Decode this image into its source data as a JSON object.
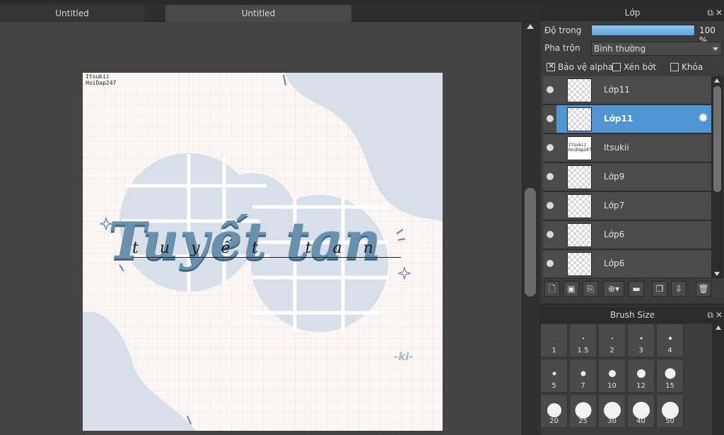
{
  "tabs": [
    "Untitled",
    "Untitled"
  ],
  "canvas": {
    "watermark_line1": "Itsukii",
    "watermark_line2": "HoiDap247",
    "headline": "Tuyết tan",
    "script_text": "tuyết tan",
    "signature": "-ki-",
    "colors": {
      "paper": "#fbf6f4",
      "grid": "#eadfe0",
      "blob": "#d7e0e8",
      "lettering": "#5f89a6"
    }
  },
  "layer_panel": {
    "title": "Lớp",
    "opacity_label": "Độ trong",
    "opacity_value": "100 %",
    "blend_label": "Pha trộn",
    "blend_value": "Bình thường",
    "checks": [
      {
        "label": "Bảo vệ alpha",
        "checked": true
      },
      {
        "label": "Xén bớt",
        "checked": false
      },
      {
        "label": "Khóa",
        "checked": false
      }
    ],
    "layers": [
      {
        "name": "Lớp11",
        "selected": false,
        "thumb": "transparent"
      },
      {
        "name": "Lớp11",
        "selected": true,
        "thumb": "transparent"
      },
      {
        "name": "Itsukii",
        "selected": false,
        "thumb": "text"
      },
      {
        "name": "Lớp9",
        "selected": false,
        "thumb": "transparent"
      },
      {
        "name": "Lớp7",
        "selected": false,
        "thumb": "transparent"
      },
      {
        "name": "Lớp6",
        "selected": false,
        "thumb": "transparent"
      },
      {
        "name": "Lớp6",
        "selected": false,
        "thumb": "transparent"
      }
    ],
    "thumb_text": "Itsukii HoiDap247"
  },
  "brush_panel": {
    "title": "Brush Size",
    "sizes": [
      "1",
      "1.5",
      "2",
      "3",
      "4",
      "5",
      "7",
      "10",
      "12",
      "15",
      "20",
      "25",
      "30",
      "40",
      "50"
    ]
  }
}
